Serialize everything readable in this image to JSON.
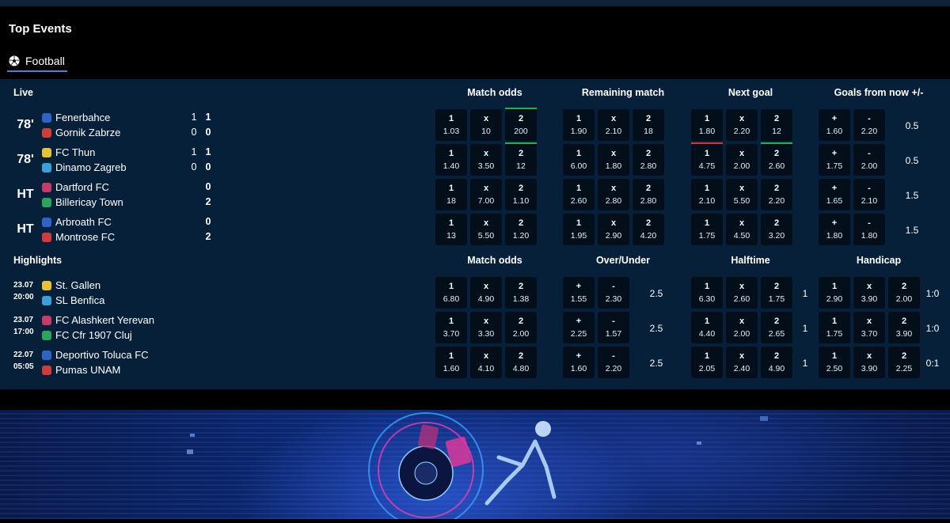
{
  "section": {
    "title": "Top Events"
  },
  "tab": {
    "label": "Football"
  },
  "live": {
    "label": "Live",
    "market_headers": [
      "Match odds",
      "Remaining match",
      "Next goal",
      "Goals from now +/-"
    ],
    "matches": [
      {
        "time": "78'",
        "home": "Fenerbahce",
        "away": "Gornik Zabrze",
        "home_score1": "1",
        "home_score2": "1",
        "away_score1": "0",
        "away_score2": "0",
        "odds": [
          {
            "l": "1",
            "v": "1.03"
          },
          {
            "l": "x",
            "v": "10"
          },
          {
            "l": "2",
            "v": "200"
          },
          {
            "l": "1",
            "v": "1.90"
          },
          {
            "l": "x",
            "v": "2.10"
          },
          {
            "l": "2",
            "v": "18"
          },
          {
            "l": "1",
            "v": "1.80"
          },
          {
            "l": "x",
            "v": "2.20"
          },
          {
            "l": "2",
            "v": "12"
          },
          {
            "l": "+",
            "v": "1.60"
          },
          {
            "l": "-",
            "v": "2.20"
          }
        ],
        "line": "0.5"
      },
      {
        "time": "78'",
        "home": "FC Thun",
        "away": "Dinamo Zagreb",
        "home_score1": "1",
        "home_score2": "1",
        "away_score1": "0",
        "away_score2": "0",
        "odds": [
          {
            "l": "1",
            "v": "1.40"
          },
          {
            "l": "x",
            "v": "3.50"
          },
          {
            "l": "2",
            "v": "12"
          },
          {
            "l": "1",
            "v": "6.00"
          },
          {
            "l": "x",
            "v": "1.80"
          },
          {
            "l": "2",
            "v": "2.80"
          },
          {
            "l": "1",
            "v": "4.75"
          },
          {
            "l": "x",
            "v": "2.00"
          },
          {
            "l": "2",
            "v": "2.60"
          },
          {
            "l": "+",
            "v": "1.75"
          },
          {
            "l": "-",
            "v": "2.00"
          }
        ],
        "line": "0.5"
      },
      {
        "time": "HT",
        "home": "Dartford FC",
        "away": "Billericay Town",
        "home_score1": "",
        "home_score2": "0",
        "away_score1": "",
        "away_score2": "2",
        "odds": [
          {
            "l": "1",
            "v": "18"
          },
          {
            "l": "x",
            "v": "7.00"
          },
          {
            "l": "2",
            "v": "1.10"
          },
          {
            "l": "1",
            "v": "2.60"
          },
          {
            "l": "x",
            "v": "2.80"
          },
          {
            "l": "2",
            "v": "2.80"
          },
          {
            "l": "1",
            "v": "2.10"
          },
          {
            "l": "x",
            "v": "5.50"
          },
          {
            "l": "2",
            "v": "2.20"
          },
          {
            "l": "+",
            "v": "1.65"
          },
          {
            "l": "-",
            "v": "2.10"
          }
        ],
        "line": "1.5"
      },
      {
        "time": "HT",
        "home": "Arbroath FC",
        "away": "Montrose FC",
        "home_score1": "",
        "home_score2": "0",
        "away_score1": "",
        "away_score2": "2",
        "odds": [
          {
            "l": "1",
            "v": "13"
          },
          {
            "l": "x",
            "v": "5.50"
          },
          {
            "l": "2",
            "v": "1.20"
          },
          {
            "l": "1",
            "v": "1.95"
          },
          {
            "l": "x",
            "v": "2.90"
          },
          {
            "l": "2",
            "v": "4.20"
          },
          {
            "l": "1",
            "v": "1.75"
          },
          {
            "l": "x",
            "v": "4.50"
          },
          {
            "l": "2",
            "v": "3.20"
          },
          {
            "l": "+",
            "v": "1.80"
          },
          {
            "l": "-",
            "v": "1.80"
          }
        ],
        "line": "1.5"
      }
    ]
  },
  "highlights": {
    "label": "Highlights",
    "market_headers": [
      "Match odds",
      "Over/Under",
      "Halftime",
      "Handicap"
    ],
    "matches": [
      {
        "date": "23.07",
        "time": "20:00",
        "home": "St. Gallen",
        "away": "SL Benfica",
        "odds": [
          {
            "l": "1",
            "v": "6.80"
          },
          {
            "l": "x",
            "v": "4.90"
          },
          {
            "l": "2",
            "v": "1.38"
          },
          {
            "l": "+",
            "v": "1.55"
          },
          {
            "l": "-",
            "v": "2.30"
          },
          {
            "l": "1",
            "v": "6.30"
          },
          {
            "l": "x",
            "v": "2.60"
          },
          {
            "l": "2",
            "v": "1.75"
          },
          {
            "l": "1",
            "v": "2.90"
          },
          {
            "l": "x",
            "v": "3.90"
          },
          {
            "l": "2",
            "v": "2.00"
          }
        ],
        "ou_line": "2.5",
        "ht_line": "1",
        "hc_line": "1:0"
      },
      {
        "date": "23.07",
        "time": "17:00",
        "home": "FC Alashkert Yerevan",
        "away": "FC Cfr 1907 Cluj",
        "odds": [
          {
            "l": "1",
            "v": "3.70"
          },
          {
            "l": "x",
            "v": "3.30"
          },
          {
            "l": "2",
            "v": "2.00"
          },
          {
            "l": "+",
            "v": "2.25"
          },
          {
            "l": "-",
            "v": "1.57"
          },
          {
            "l": "1",
            "v": "4.40"
          },
          {
            "l": "x",
            "v": "2.00"
          },
          {
            "l": "2",
            "v": "2.65"
          },
          {
            "l": "1",
            "v": "1.75"
          },
          {
            "l": "x",
            "v": "3.70"
          },
          {
            "l": "2",
            "v": "3.90"
          }
        ],
        "ou_line": "2.5",
        "ht_line": "1",
        "hc_line": "1:0"
      },
      {
        "date": "22.07",
        "time": "05:05",
        "home": "Deportivo Toluca FC",
        "away": "Pumas UNAM",
        "odds": [
          {
            "l": "1",
            "v": "1.60"
          },
          {
            "l": "x",
            "v": "4.10"
          },
          {
            "l": "2",
            "v": "4.80"
          },
          {
            "l": "+",
            "v": "1.60"
          },
          {
            "l": "-",
            "v": "2.20"
          },
          {
            "l": "1",
            "v": "2.05"
          },
          {
            "l": "x",
            "v": "2.40"
          },
          {
            "l": "2",
            "v": "4.90"
          },
          {
            "l": "1",
            "v": "2.50"
          },
          {
            "l": "x",
            "v": "3.90"
          },
          {
            "l": "2",
            "v": "2.25"
          }
        ],
        "ou_line": "2.5",
        "ht_line": "1",
        "hc_line": "0:1"
      }
    ]
  },
  "colors": {
    "panel": "#06203a",
    "odd_bg": "#030e1b",
    "tab_underline": "#3f86d8",
    "odds_up": "#1fb34a",
    "odds_down": "#e0302a"
  },
  "icons": {
    "tab": "soccer-ball-icon"
  }
}
